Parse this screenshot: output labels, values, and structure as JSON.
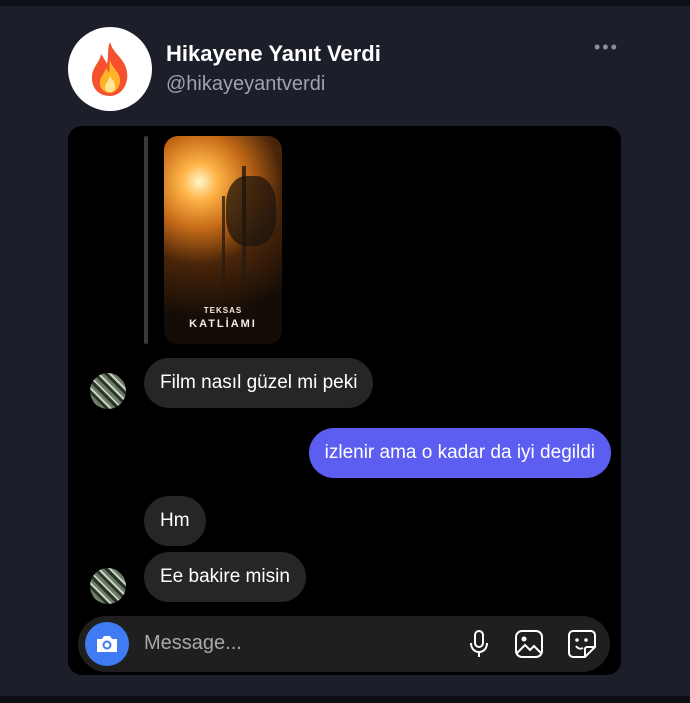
{
  "profile": {
    "name": "Hikayene Yanıt Verdi",
    "handle": "@hikayeyantverdi",
    "more_icon": "more-dots-icon",
    "avatar_icon": "fire-emoji-icon"
  },
  "story": {
    "line1": "TEKSAS",
    "line2": "KATLİAMI"
  },
  "messages": [
    {
      "side": "in",
      "text": "Film nasıl güzel mi peki"
    },
    {
      "side": "out",
      "text": "izlenir ama o kadar da iyi degildi"
    },
    {
      "side": "in",
      "text": "Hm"
    },
    {
      "side": "in",
      "text": "Ee bakire misin"
    }
  ],
  "composer": {
    "placeholder": "Message...",
    "icons": [
      "camera-icon",
      "microphone-icon",
      "gallery-icon",
      "sticker-icon"
    ],
    "accent": "#3f7bf2"
  },
  "colors": {
    "outgoing_bubble": "#5b5ef0",
    "incoming_bubble": "#262626"
  }
}
